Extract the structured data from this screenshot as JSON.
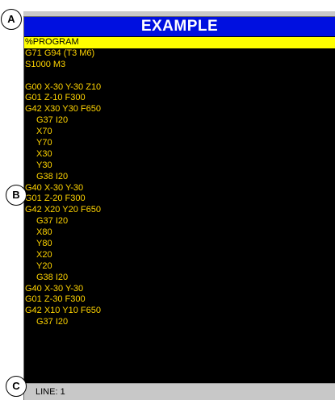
{
  "title": "EXAMPLE",
  "program_lines": [
    {
      "text": "%PROGRAM",
      "indent": false,
      "selected": true
    },
    {
      "text": "G71 G94 (T3 M6)",
      "indent": false,
      "selected": false
    },
    {
      "text": "S1000 M3",
      "indent": false,
      "selected": false
    },
    {
      "text": "",
      "indent": false,
      "selected": false
    },
    {
      "text": "G00 X-30 Y-30 Z10",
      "indent": false,
      "selected": false
    },
    {
      "text": "G01 Z-10 F300",
      "indent": false,
      "selected": false
    },
    {
      "text": "G42 X30 Y30 F650",
      "indent": false,
      "selected": false
    },
    {
      "text": "G37 I20",
      "indent": true,
      "selected": false
    },
    {
      "text": "X70",
      "indent": true,
      "selected": false
    },
    {
      "text": "Y70",
      "indent": true,
      "selected": false
    },
    {
      "text": "X30",
      "indent": true,
      "selected": false
    },
    {
      "text": "Y30",
      "indent": true,
      "selected": false
    },
    {
      "text": "G38 I20",
      "indent": true,
      "selected": false
    },
    {
      "text": "G40 X-30 Y-30",
      "indent": false,
      "selected": false
    },
    {
      "text": "G01 Z-20 F300",
      "indent": false,
      "selected": false
    },
    {
      "text": "G42 X20 Y20 F650",
      "indent": false,
      "selected": false
    },
    {
      "text": "G37 I20",
      "indent": true,
      "selected": false
    },
    {
      "text": "X80",
      "indent": true,
      "selected": false
    },
    {
      "text": "Y80",
      "indent": true,
      "selected": false
    },
    {
      "text": "X20",
      "indent": true,
      "selected": false
    },
    {
      "text": "Y20",
      "indent": true,
      "selected": false
    },
    {
      "text": "G38 I20",
      "indent": true,
      "selected": false
    },
    {
      "text": "G40 X-30 Y-30",
      "indent": false,
      "selected": false
    },
    {
      "text": "G01 Z-30 F300",
      "indent": false,
      "selected": false
    },
    {
      "text": "G42 X10 Y10 F650",
      "indent": false,
      "selected": false
    },
    {
      "text": "G37 I20",
      "indent": true,
      "selected": false
    }
  ],
  "status": "LINE: 1",
  "callouts": {
    "a": "A",
    "b": "B",
    "c": "C"
  },
  "colors": {
    "title_bar": "#0010e0",
    "code_text": "#ffd400",
    "selected_line": "#ffff00",
    "editor_background": "#000000",
    "status_bar": "#c8c8c8"
  }
}
